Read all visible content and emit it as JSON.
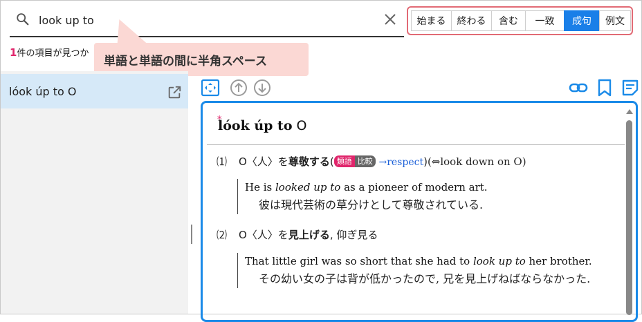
{
  "search": {
    "value": "look up to",
    "icon": "search-icon",
    "clear_icon": "close-icon"
  },
  "filters": [
    {
      "label": "始まる",
      "active": false
    },
    {
      "label": "終わる",
      "active": false
    },
    {
      "label": "含む",
      "active": false
    },
    {
      "label": "一致",
      "active": false
    },
    {
      "label": "成句",
      "active": true
    },
    {
      "label": "例文",
      "active": false
    }
  ],
  "results": {
    "count": "1",
    "suffix": "件の項目が見つか"
  },
  "tooltip": "単語と単語の間に半角スペース",
  "sidebar": {
    "items": [
      {
        "label": "lóok úp to O",
        "selected": true
      }
    ]
  },
  "toolbar_icons": [
    "expand-icon",
    "arrow-up-icon",
    "arrow-down-icon",
    "link-icon",
    "bookmark-icon",
    "note-icon"
  ],
  "entry": {
    "asterisk": "*",
    "headword": "lóok úp to",
    "headword_obj": "O",
    "senses": [
      {
        "number": "1",
        "definition_pre": "O〈人〉を",
        "definition_bold": "尊敬する",
        "paren_open": "(",
        "tag_synonym": "類語",
        "tag_compare": "比較",
        "xref": "→respect",
        "paren_close": ")",
        "antonym": "(⇔look down on O)",
        "example_en_1": "He is ",
        "example_en_em": "looked up to",
        "example_en_2": " as a pioneer of modern art.",
        "example_ja": "彼は現代芸術の草分けとして尊敬されている."
      },
      {
        "number": "2",
        "definition_pre": "O〈人〉を",
        "definition_bold": "見上げる",
        "definition_post": ", 仰ぎ見る",
        "example_en_1": "That little girl was so short that she had to ",
        "example_en_em": "look up to",
        "example_en_2": " her brother.",
        "example_ja": "その幼い女の子は背が低かったので, 兄を見上げねばならなかった."
      }
    ]
  },
  "colors": {
    "accent": "#1a7fe8",
    "filter_border": "#e26a75",
    "count_number": "#e0256b",
    "tooltip_bg": "#fbd8d4",
    "selected_item_bg": "#d6e9f8"
  }
}
